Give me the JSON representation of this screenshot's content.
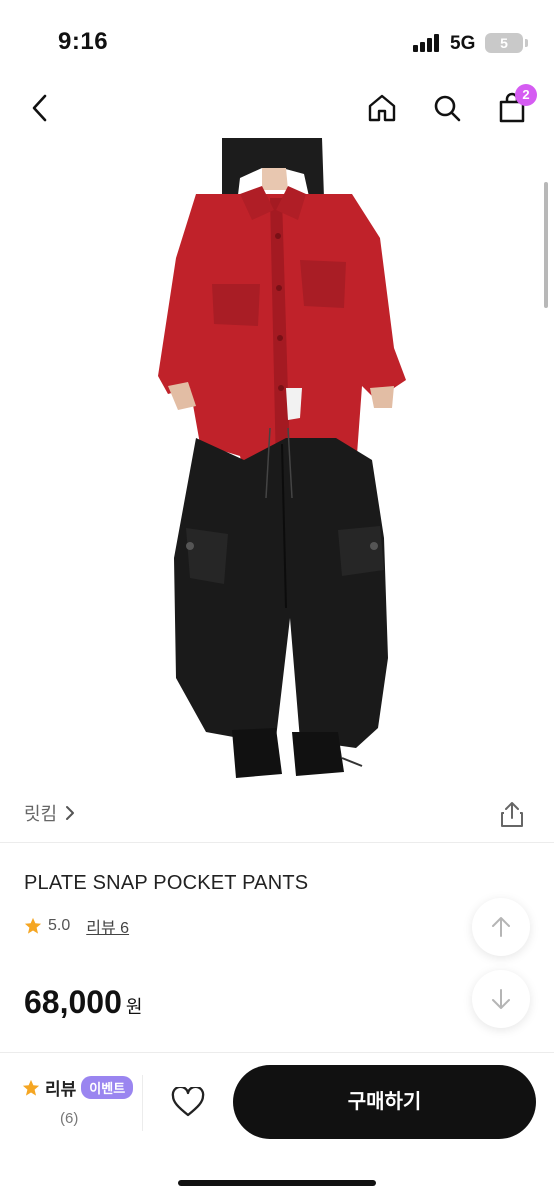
{
  "status_bar": {
    "time": "9:16",
    "network": "5G",
    "battery": "5",
    "icons": [
      "signal-bars-icon",
      "battery-charging-icon"
    ]
  },
  "nav": {
    "icons": [
      "chevron-left-icon",
      "home-icon",
      "search-icon",
      "shopping-bag-icon"
    ],
    "cart_count": "2",
    "accent": "#d55cf2"
  },
  "product": {
    "brand": "릿킴",
    "title": "PLATE SNAP POCKET PANTS",
    "rating": "5.0",
    "review_link": "리뷰 6",
    "price": "68,000",
    "price_unit": "원",
    "image": "model-wearing-red-shirt-black-pants"
  },
  "bottom_bar": {
    "review_label": "리뷰",
    "event_badge": "이벤트",
    "review_count": "(6)",
    "buy_label": "구매하기"
  },
  "colors": {
    "star": "#f5a623",
    "event_badge": "#9a85f0",
    "buy_button": "#111111"
  }
}
